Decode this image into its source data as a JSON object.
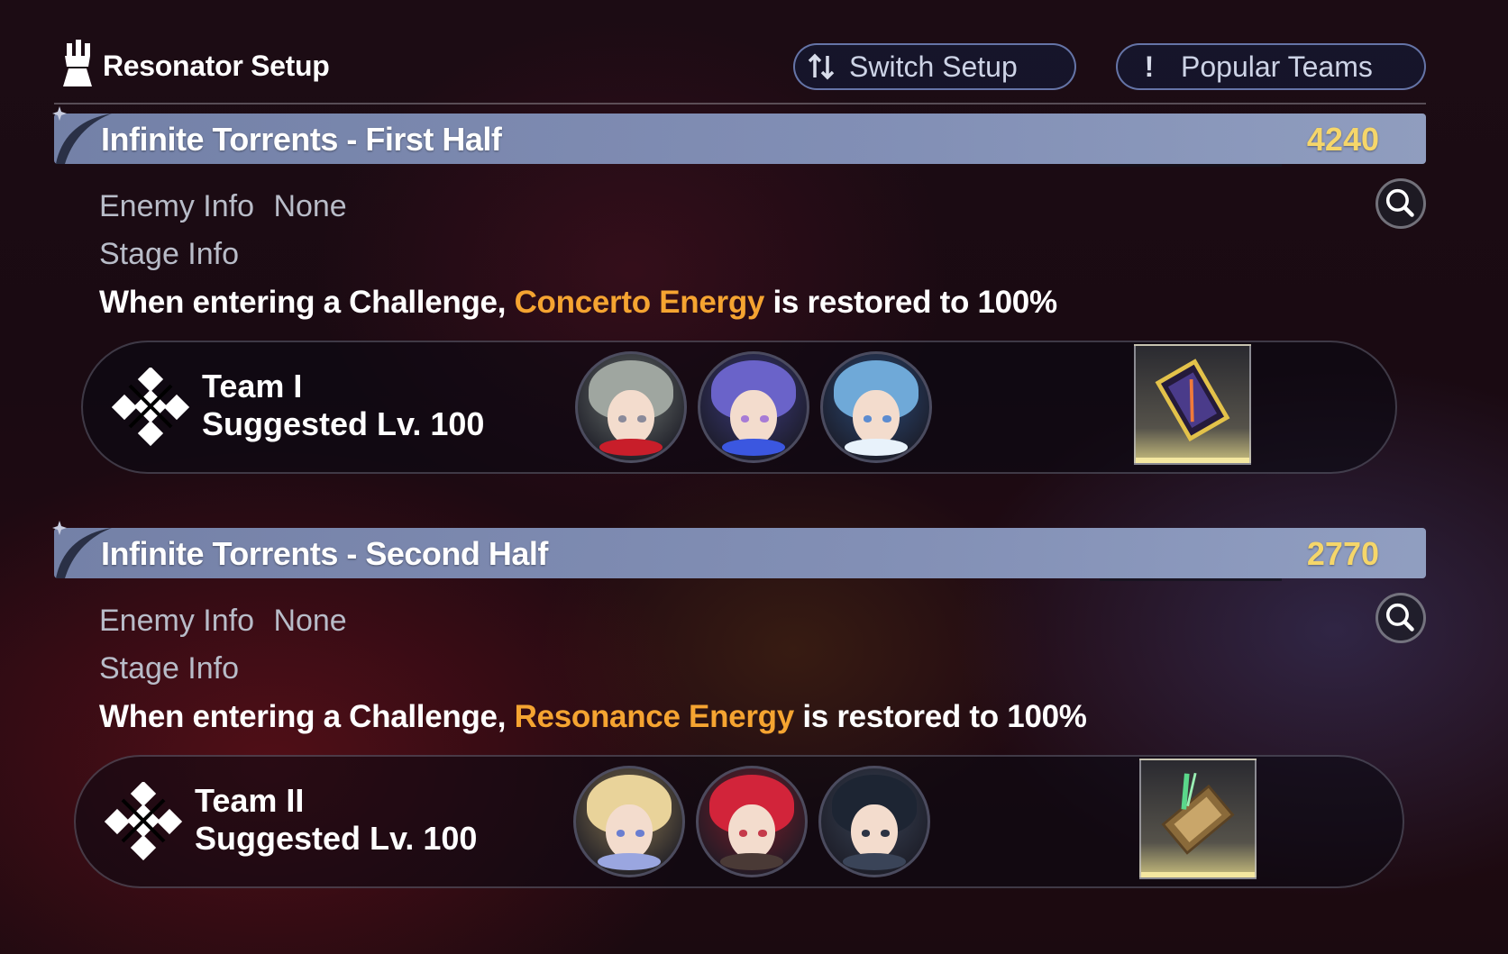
{
  "header": {
    "title": "Resonator Setup",
    "switch_setup_label": "Switch Setup",
    "switch_setup_icon": "sort-arrows-icon",
    "popular_teams_label": "Popular Teams",
    "popular_teams_icon": "exclamation-icon"
  },
  "sections": [
    {
      "title": "Infinite Torrents - First Half",
      "score": "4240",
      "enemy_info_label": "Enemy Info",
      "enemy_info_value": "None",
      "stage_info_label": "Stage Info",
      "desc_prefix": "When entering a Challenge, ",
      "desc_highlight": "Concerto Energy",
      "desc_suffix": " is restored to 100%",
      "team_name": "Team I",
      "suggested_level": "Suggested Lv. 100",
      "portraits": [
        {
          "hair": "#9fa6a0",
          "accent": "#c81e2a",
          "bg": "#6d7470",
          "eye": "#8a8a9a"
        },
        {
          "hair": "#6a63c9",
          "accent": "#3b57e0",
          "bg": "#3c3a7c",
          "eye": "#a77bd6"
        },
        {
          "hair": "#6fa9d8",
          "accent": "#e8f2fb",
          "bg": "#2c4a78",
          "eye": "#5c8cd0"
        }
      ],
      "item_icon": "echo-frame-icon"
    },
    {
      "title": "Infinite Torrents - Second Half",
      "score": "2770",
      "enemy_info_label": "Enemy Info",
      "enemy_info_value": "None",
      "stage_info_label": "Stage Info",
      "desc_prefix": "When entering a Challenge, ",
      "desc_highlight": "Resonance Energy",
      "desc_suffix": " is restored to 100%",
      "team_name": "Team II",
      "suggested_level": "Suggested Lv. 100",
      "portraits": [
        {
          "hair": "#e9d39a",
          "accent": "#9aa6e0",
          "bg": "#8a7650",
          "eye": "#6a7ed0"
        },
        {
          "hair": "#d2243a",
          "accent": "#4a3a36",
          "bg": "#7a1d2a",
          "eye": "#c53a4a"
        },
        {
          "hair": "#1d2533",
          "accent": "#3a4458",
          "bg": "#3a4456",
          "eye": "#2c3444"
        }
      ],
      "item_icon": "jade-tablet-icon"
    }
  ],
  "colors": {
    "highlight": "#f5a431",
    "score": "#f5d66a",
    "banner": "#8793b8"
  }
}
